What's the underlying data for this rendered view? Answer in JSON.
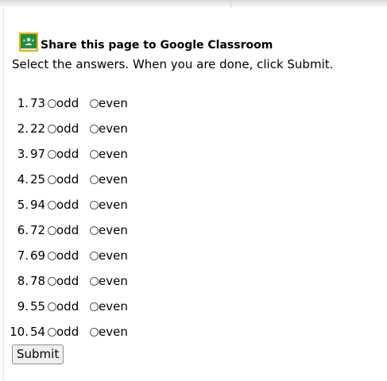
{
  "share": {
    "text": "Share this page to Google Classroom",
    "icon": "google-classroom-icon",
    "icon_color": "#1e8e3e",
    "icon_accent": "#f9ab00"
  },
  "instructions": "Select the answers. When you are done, click Submit.",
  "options": {
    "odd": "odd",
    "even": "even"
  },
  "questions": [
    {
      "num": "1.",
      "value": "73"
    },
    {
      "num": "2.",
      "value": "22"
    },
    {
      "num": "3.",
      "value": "97"
    },
    {
      "num": "4.",
      "value": "25"
    },
    {
      "num": "5.",
      "value": "94"
    },
    {
      "num": "6.",
      "value": "72"
    },
    {
      "num": "7.",
      "value": "69"
    },
    {
      "num": "8.",
      "value": "78"
    },
    {
      "num": "9.",
      "value": "55"
    },
    {
      "num": "10.",
      "value": "54"
    }
  ],
  "submit_label": "Submit"
}
